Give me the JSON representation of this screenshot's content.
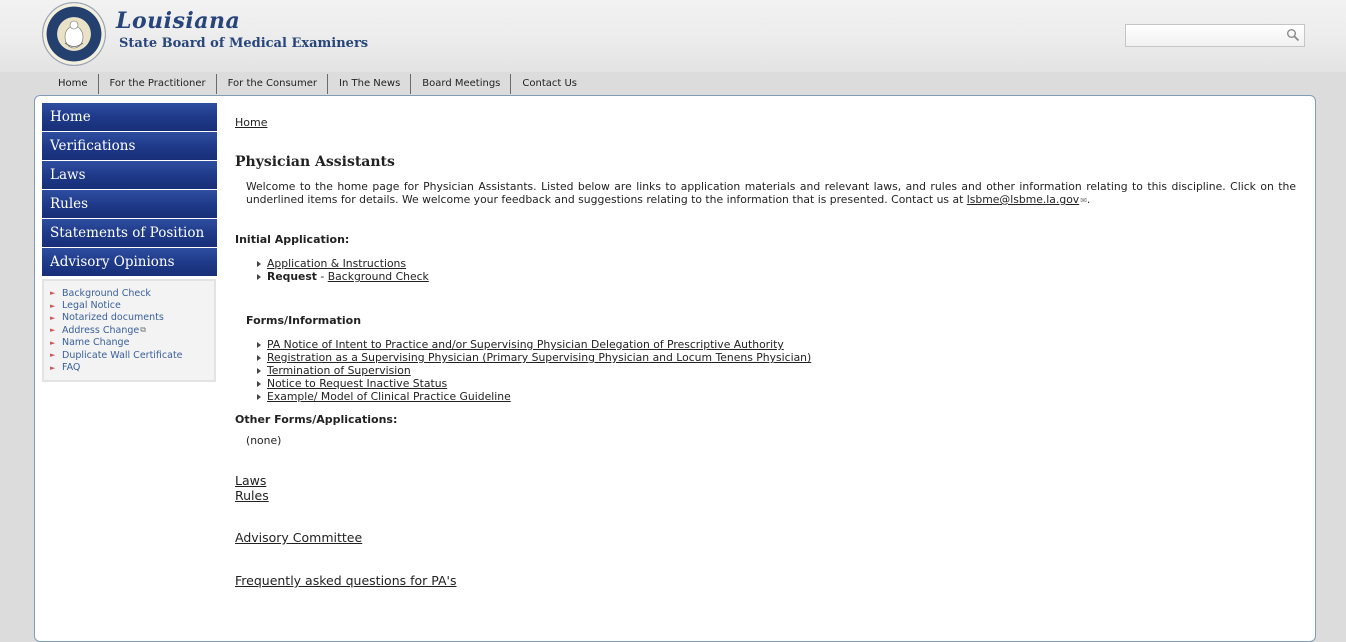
{
  "header": {
    "logo_script": "Louisiana",
    "logo_sub": "State Board of Medical Examiners",
    "search_placeholder": ""
  },
  "topnav": [
    "Home",
    "For the Practitioner",
    "For the Consumer",
    "In The News",
    "Board Meetings",
    "Contact Us"
  ],
  "leftnav": [
    "Home",
    "Verifications",
    "Laws",
    "Rules",
    "Statements of Position",
    "Advisory Opinions"
  ],
  "quicklinks": [
    "Background Check",
    "Legal Notice",
    "Notarized documents",
    "Address Change",
    "Name Change",
    "Duplicate Wall Certificate",
    "FAQ"
  ],
  "content": {
    "breadcrumb": "Home",
    "title": "Physician Assistants",
    "intro_text": "Welcome to the home page for Physician Assistants. Listed below are links to application materials and relevant laws, and rules and other information relating to this discipline. Click on the underlined items for details. We welcome your feedback and suggestions relating to the information that is presented. Contact us at ",
    "intro_email": "lsbme@lsbme.la.gov",
    "intro_end": ".",
    "initial_title": "Initial Application:",
    "initial_items": {
      "app_instructions": "Application & Instructions",
      "request_label": "Request",
      "request_sep": " - ",
      "background_check": "Background Check"
    },
    "forms_title": "Forms/Information",
    "forms_items": [
      "PA Notice of Intent to Practice and/or Supervising Physician Delegation of Prescriptive Authority",
      "Registration as a Supervising Physician (Primary Supervising Physician and Locum Tenens Physician)",
      "Termination of Supervision",
      "Notice to Request Inactive Status",
      "Example/ Model of Clinical Practice Guideline"
    ],
    "other_title": "Other Forms/Applications:",
    "other_value": "(none)",
    "laws_link": "Laws",
    "rules_link": "Rules",
    "advisory_link": "Advisory Committee",
    "faq_link": "Frequently asked questions for PA's"
  },
  "colors": {
    "nav_blue": "#1f3a8a",
    "link_blue": "#3a5f9c",
    "panel_border": "#7f9db9"
  },
  "icons": [
    "seal-logo",
    "search-icon",
    "external-link-icon",
    "mail-icon",
    "arrow-bullet-icon"
  ]
}
